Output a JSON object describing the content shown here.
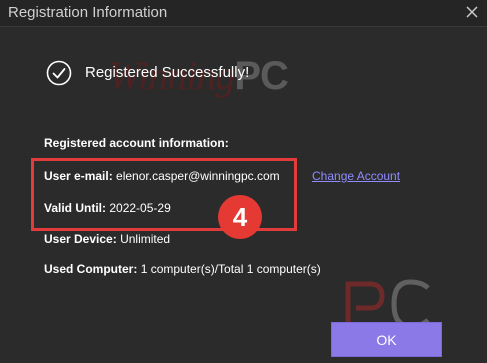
{
  "window": {
    "title": "Registration Information",
    "close_icon": "close-icon"
  },
  "watermark": {
    "script": "Winning",
    "bold": "PC"
  },
  "status": {
    "icon": "check-circle-icon",
    "message": "Registered Successfully!"
  },
  "account": {
    "section_title": "Registered account information:",
    "email_label": "User e-mail:",
    "email_value": "elenor.casper@winningpc.com",
    "valid_label": "Valid Until:",
    "valid_value": "2022-05-29",
    "device_label": "User Device:",
    "device_value": "Unlimited",
    "computer_label": "Used Computer:",
    "computer_value": "1 computer(s)/Total 1 computer(s)",
    "change_link": "Change Account"
  },
  "annotation": {
    "step_number": "4",
    "color": "#e53a34"
  },
  "logo": {
    "text": "PC"
  },
  "buttons": {
    "ok_label": "OK",
    "ok_color": "#8a79e6"
  }
}
